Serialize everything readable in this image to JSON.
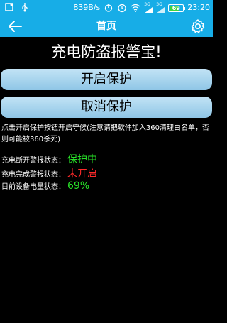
{
  "statusbar": {
    "speed": "839B/s",
    "network1": "3G",
    "network2": "3G",
    "battery": "69",
    "battery_level": 0.69,
    "time": "23:20"
  },
  "appbar": {
    "title": "首页"
  },
  "main": {
    "heading": "充电防盗报警宝!",
    "start_button": "开启保护",
    "cancel_button": "取消保护",
    "hint": "点击开启保护按钮开启守候(注意请把软件加入360清理白名单，否则可能被360杀死)"
  },
  "status": {
    "charge_disconnect_label": "充电断开警报状态：",
    "charge_disconnect_value": "保护中",
    "charge_complete_label": "充电完成警报状态：",
    "charge_complete_value": "未开启",
    "battery_label": "目前设备电量状态：",
    "battery_value": "69%"
  },
  "colors": {
    "bar": "#17ade7",
    "active": "#28e028",
    "inactive": "#ff2a2a",
    "button": "#a9d6ef"
  }
}
